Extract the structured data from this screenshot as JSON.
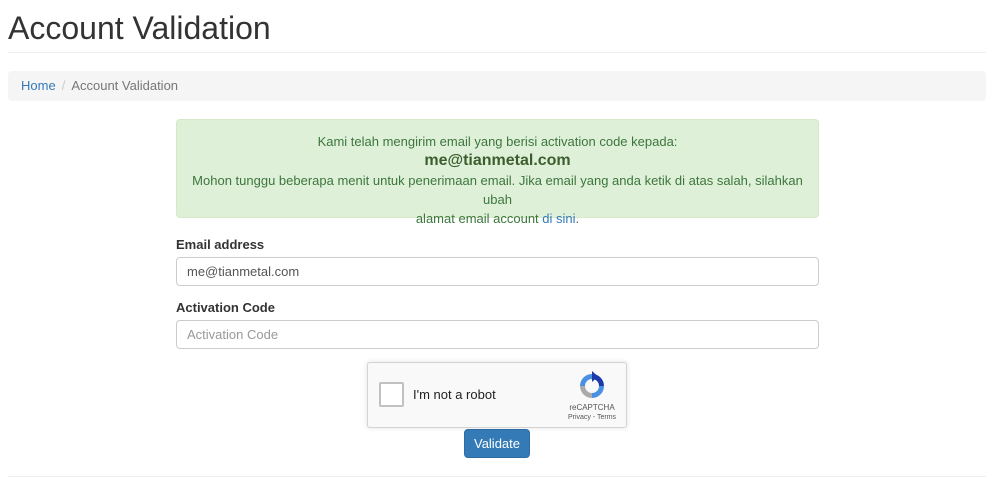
{
  "page": {
    "title": "Account Validation"
  },
  "breadcrumb": {
    "home": "Home",
    "separator": "/",
    "current": "Account Validation"
  },
  "alert": {
    "line1": "Kami telah mengirim email yang berisi activation code kepada:",
    "email": "me@tianmetal.com",
    "line3": "Mohon tunggu beberapa menit untuk penerimaan email. Jika email yang anda ketik di atas salah, silahkan ubah",
    "line4_prefix": "alamat email account ",
    "link_text": "di sini",
    "line4_suffix": "."
  },
  "form": {
    "email_label": "Email address",
    "email_value": "me@tianmetal.com",
    "code_label": "Activation Code",
    "code_placeholder": "Activation Code",
    "submit_label": "Validate"
  },
  "recaptcha": {
    "checkbox_label": "I'm not a robot",
    "brand": "reCAPTCHA",
    "privacy": "Privacy",
    "terms_sep": " - ",
    "terms": "Terms"
  },
  "colors": {
    "primary": "#337ab7",
    "alert_bg": "#dff0d8",
    "alert_text": "#3c763d"
  }
}
